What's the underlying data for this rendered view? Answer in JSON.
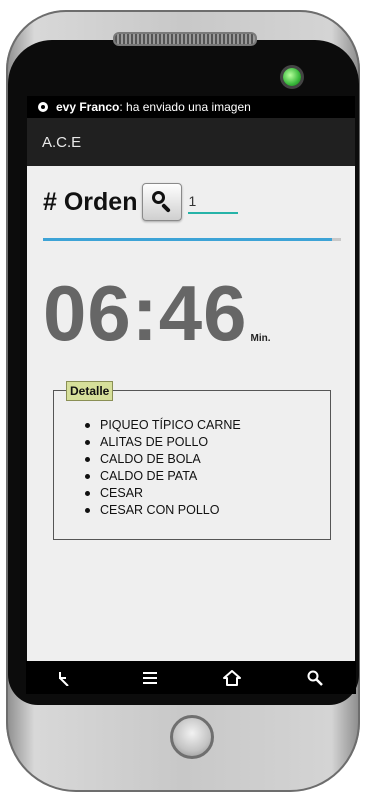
{
  "status_bar": {
    "notification_sender": "evy Franco",
    "notification_text": ": ha enviado una imagen"
  },
  "app_bar": {
    "title": "A.C.E"
  },
  "order": {
    "label": "# Orden",
    "search_icon": "search-icon",
    "input_value": "1"
  },
  "progress": {
    "fill_fraction": 0.97
  },
  "timer": {
    "value": "06:46",
    "unit": "Min."
  },
  "detail": {
    "legend": "Detalle",
    "items": [
      "PIQUEO TÍPICO CARNE",
      "ALITAS DE POLLO",
      "CALDO DE BOLA",
      "CALDO DE PATA",
      "CESAR",
      "CESAR CON POLLO"
    ]
  },
  "nav": {
    "icons": [
      "back-icon",
      "menu-icon",
      "home-icon",
      "search-icon"
    ]
  },
  "colors": {
    "accent": "#3da3d6",
    "input_underline": "#26b3a8",
    "legend_bg": "#d6df9a",
    "timer_text": "#666666"
  }
}
